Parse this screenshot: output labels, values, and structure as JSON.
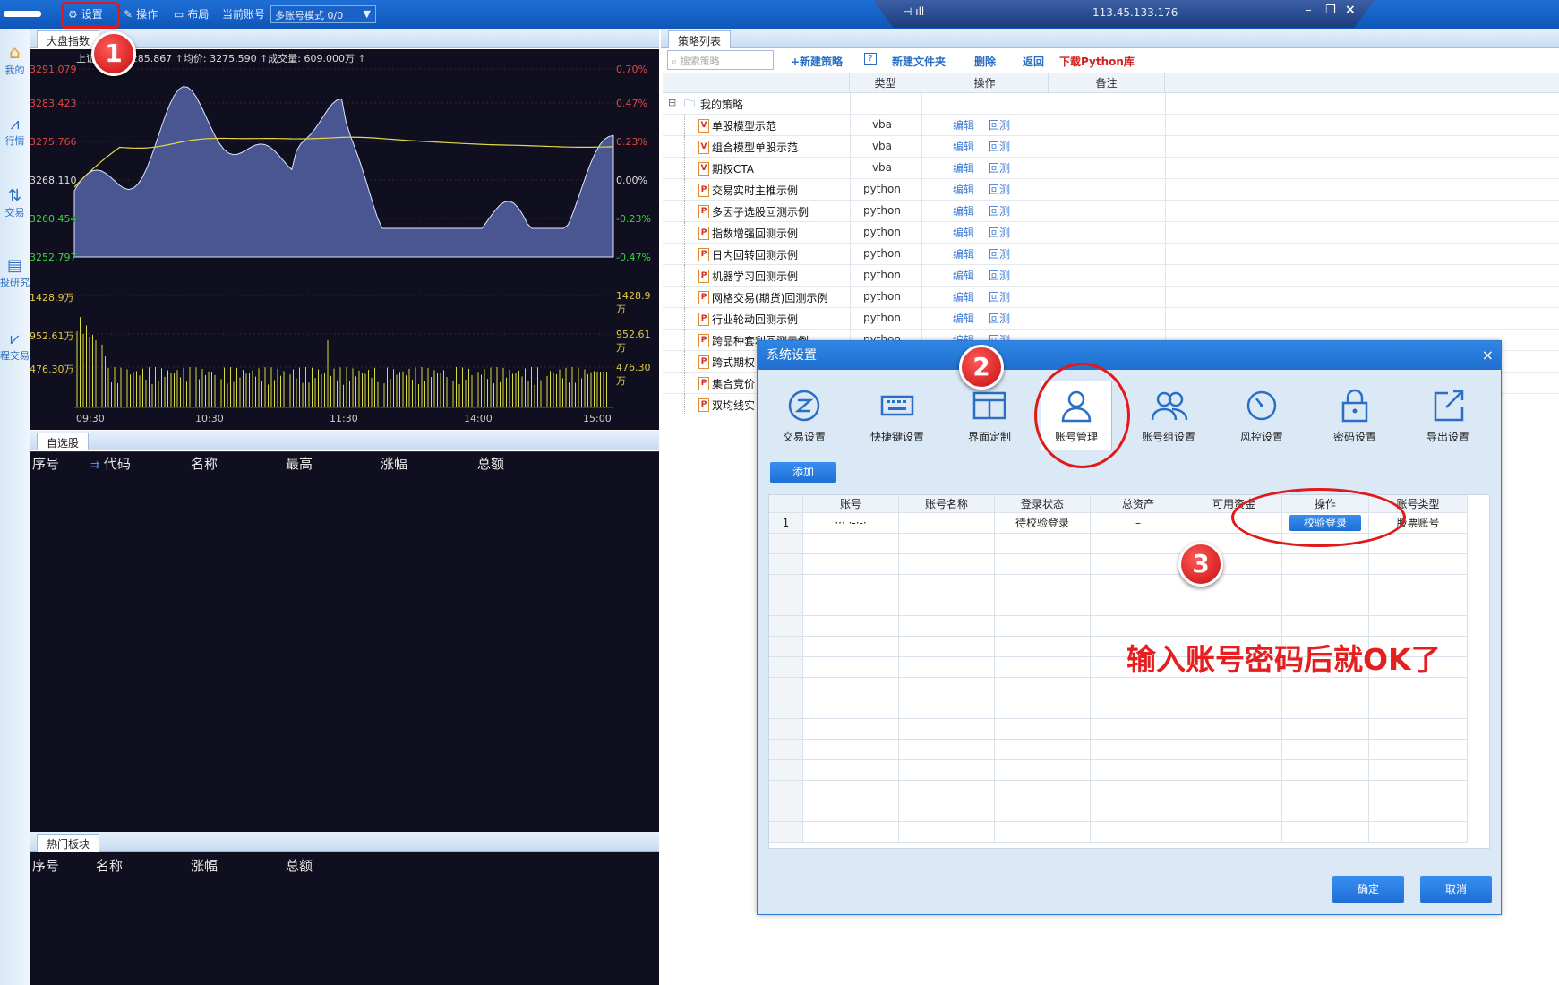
{
  "topbar": {
    "settings": "设置",
    "operate": "操作",
    "layout": "布局",
    "current_account_label": "当前账号",
    "account_mode": "多账号模式 0/0",
    "ip": "113.45.133.176"
  },
  "leftnav": [
    "我的",
    "行情",
    "交易",
    "投研究",
    "程交易"
  ],
  "market": {
    "tab": "大盘指数",
    "info": "上证  新价: 3285.867 ↑均价: 3275.590 ↑成交量: 609.000万 ↑",
    "left_axis": [
      "3291.079",
      "3283.423",
      "3275.766",
      "3268.110",
      "3260.454",
      "3252.797",
      "1428.9万",
      "952.61万",
      "476.30万"
    ],
    "right_axis": [
      "0.70%",
      "0.47%",
      "0.23%",
      "0.00%",
      "-0.23%",
      "-0.47%",
      "1428.9万",
      "952.61万",
      "476.30万"
    ],
    "times": [
      "09:30",
      "10:30",
      "11:30",
      "14:00",
      "15:00"
    ]
  },
  "watchlist": {
    "tab": "自选股",
    "columns": [
      "序号",
      "代码",
      "名称",
      "最高",
      "涨幅",
      "总额"
    ]
  },
  "hot": {
    "tab": "热门板块",
    "columns": [
      "序号",
      "名称",
      "涨幅",
      "总额"
    ]
  },
  "strategy": {
    "tab": "策略列表",
    "search_placeholder": "搜索策略",
    "new_strategy": "+新建策略",
    "help": "?",
    "new_folder": "新建文件夹",
    "delete": "删除",
    "back": "返回",
    "download": "下载Python库",
    "headers": [
      "类型",
      "操作",
      "备注"
    ],
    "folder": "我的策略",
    "edit": "编辑",
    "backtest": "回测",
    "items": [
      {
        "name": "单股模型示范",
        "type": "vba",
        "icon": "V"
      },
      {
        "name": "组合模型单股示范",
        "type": "vba",
        "icon": "V"
      },
      {
        "name": "期权CTA",
        "type": "vba",
        "icon": "V"
      },
      {
        "name": "交易实时主推示例",
        "type": "python",
        "icon": "P"
      },
      {
        "name": "多因子选股回测示例",
        "type": "python",
        "icon": "P"
      },
      {
        "name": "指数增强回测示例",
        "type": "python",
        "icon": "P"
      },
      {
        "name": "日内回转回测示例",
        "type": "python",
        "icon": "P"
      },
      {
        "name": "机器学习回测示例",
        "type": "python",
        "icon": "P"
      },
      {
        "name": "网格交易(期货)回测示例",
        "type": "python",
        "icon": "P"
      },
      {
        "name": "行业轮动回测示例",
        "type": "python",
        "icon": "P"
      },
      {
        "name": "跨品种套利回测示例",
        "type": "python",
        "icon": "P"
      },
      {
        "name": "跨式期权",
        "type": "",
        "icon": "P"
      },
      {
        "name": "集合竞价",
        "type": "",
        "icon": "P"
      },
      {
        "name": "双均线实",
        "type": "",
        "icon": "P"
      }
    ]
  },
  "dialog": {
    "title": "系统设置",
    "close": "×",
    "icons": [
      "交易设置",
      "快捷键设置",
      "界面定制",
      "账号管理",
      "账号组设置",
      "风控设置",
      "密码设置",
      "导出设置"
    ],
    "add": "添加",
    "columns": [
      "账号",
      "账号名称",
      "登录状态",
      "总资产",
      "可用资金",
      "操作",
      "账号类型"
    ],
    "row": {
      "index": "1",
      "account": "··· ·-·-·",
      "name": "",
      "status": "待校验登录",
      "assets": "–",
      "cash": "",
      "action": "校验登录",
      "type": "股票账号"
    },
    "ok": "确定",
    "cancel": "取消"
  },
  "annotations": {
    "n1": "1",
    "n2": "2",
    "n3": "3",
    "note": "输入账号密码后就OK了"
  }
}
